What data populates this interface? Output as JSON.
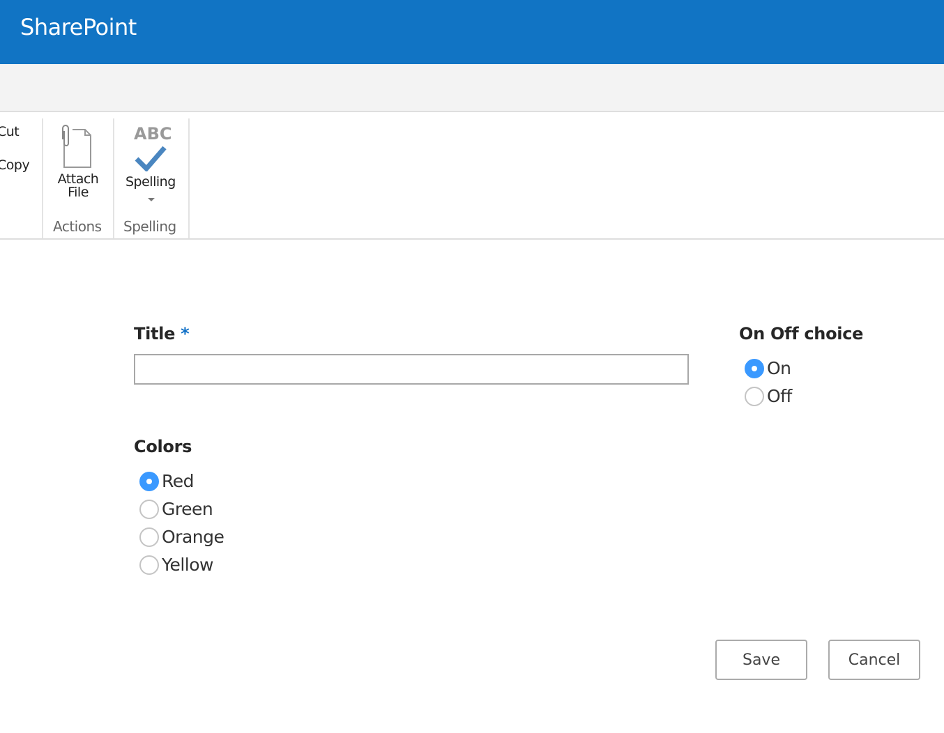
{
  "header": {
    "title": "SharePoint"
  },
  "ribbon": {
    "clipboard": {
      "cut": "Cut",
      "copy": "Copy"
    },
    "actions": {
      "attach_line1": "Attach",
      "attach_line2": "File",
      "group": "Actions"
    },
    "spelling": {
      "abc": "ABC",
      "button": "Spelling",
      "group": "Spelling"
    }
  },
  "form": {
    "title": {
      "label": "Title",
      "required": "*",
      "value": ""
    },
    "colors": {
      "label": "Colors",
      "options": [
        "Red",
        "Green",
        "Orange",
        "Yellow"
      ],
      "selected": "Red"
    },
    "onoff": {
      "label": "On Off choice",
      "options": [
        "On",
        "Off"
      ],
      "selected": "On"
    }
  },
  "buttons": {
    "save": "Save",
    "cancel": "Cancel"
  },
  "colors": {
    "brand": "#1174c4",
    "accent": "#3a99ff"
  }
}
